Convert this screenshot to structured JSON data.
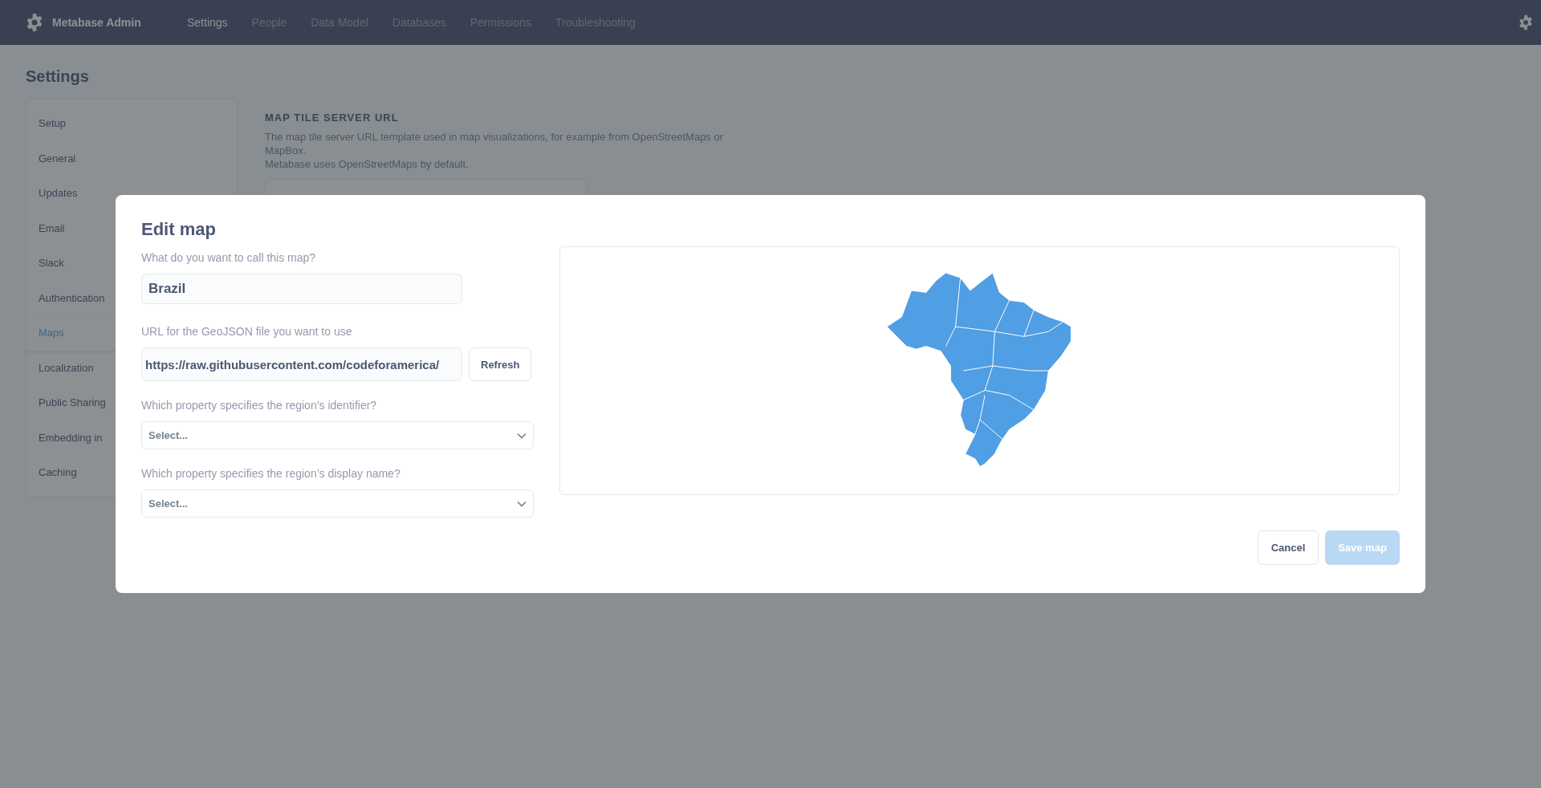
{
  "header": {
    "title": "Metabase Admin",
    "nav": [
      {
        "label": "Settings",
        "selected": true
      },
      {
        "label": "People",
        "selected": false
      },
      {
        "label": "Data Model",
        "selected": false
      },
      {
        "label": "Databases",
        "selected": false
      },
      {
        "label": "Permissions",
        "selected": false
      },
      {
        "label": "Troubleshooting",
        "selected": false
      }
    ]
  },
  "page": {
    "title": "Settings",
    "sidebar": [
      {
        "label": "Setup",
        "selected": false
      },
      {
        "label": "General",
        "selected": false
      },
      {
        "label": "Updates",
        "selected": false
      },
      {
        "label": "Email",
        "selected": false
      },
      {
        "label": "Slack",
        "selected": false
      },
      {
        "label": "Authentication",
        "selected": false
      },
      {
        "label": "Maps",
        "selected": true
      },
      {
        "label": "Localization",
        "selected": false
      },
      {
        "label": "Public Sharing",
        "selected": false
      },
      {
        "label": "Embedding in",
        "selected": false
      },
      {
        "label": "Caching",
        "selected": false
      }
    ],
    "setting": {
      "heading": "MAP TILE SERVER URL",
      "description": [
        "The map tile server URL template used in map visualizations, for example from OpenStreetMaps or MapBox.",
        "Metabase uses OpenStreetMaps by default."
      ]
    }
  },
  "dialog": {
    "title": "Edit map",
    "name_label": "What do you want to call this map?",
    "name_value": "Brazil",
    "url_label": "URL for the GeoJSON file you want to use",
    "url_value": "https://raw.githubusercontent.com/codeforamerica/",
    "refresh": "Refresh",
    "selects": [
      {
        "label": "Which property specifies the region’s identifier?",
        "placeholder": "Select..."
      },
      {
        "label": "Which property specifies the region’s display name?",
        "placeholder": "Select..."
      }
    ],
    "cancel": "Cancel",
    "save": {
      "label": "Save map",
      "disabled": true
    }
  }
}
